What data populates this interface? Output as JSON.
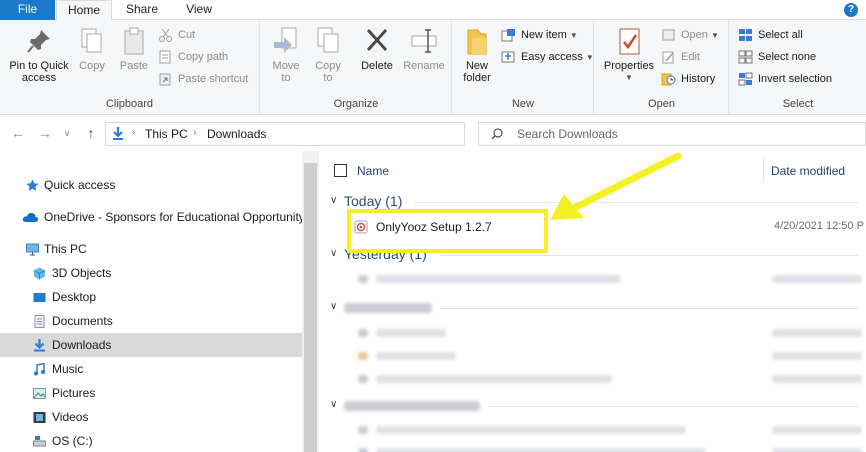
{
  "tabs": {
    "file": "File",
    "home": "Home",
    "share": "Share",
    "view": "View"
  },
  "ribbon": {
    "clipboard": {
      "label": "Clipboard",
      "pin": "Pin to Quick\naccess",
      "copy": "Copy",
      "paste": "Paste",
      "cut": "Cut",
      "copy_path": "Copy path",
      "paste_shortcut": "Paste shortcut"
    },
    "organize": {
      "label": "Organize",
      "move_to": "Move\nto",
      "copy_to": "Copy\nto",
      "delete": "Delete",
      "rename": "Rename"
    },
    "new": {
      "label": "New",
      "new_folder": "New\nfolder",
      "new_item": "New item",
      "easy_access": "Easy access"
    },
    "open": {
      "label": "Open",
      "properties": "Properties",
      "open": "Open",
      "edit": "Edit",
      "history": "History"
    },
    "select": {
      "label": "Select",
      "select_all": "Select all",
      "select_none": "Select none",
      "invert_selection": "Invert selection"
    }
  },
  "address": {
    "crumbs": [
      "This PC",
      "Downloads"
    ],
    "search_placeholder": "Search Downloads"
  },
  "navpane": {
    "items": [
      {
        "label": "Quick access",
        "icon": "star-icon"
      },
      {
        "label": "OneDrive - Sponsors for Educational Opportunity",
        "icon": "cloud-icon"
      },
      {
        "label": "This PC",
        "icon": "computer-icon"
      },
      {
        "label": "3D Objects",
        "icon": "cube-icon"
      },
      {
        "label": "Desktop",
        "icon": "desktop-icon"
      },
      {
        "label": "Documents",
        "icon": "documents-icon"
      },
      {
        "label": "Downloads",
        "icon": "download-icon"
      },
      {
        "label": "Music",
        "icon": "music-icon"
      },
      {
        "label": "Pictures",
        "icon": "pictures-icon"
      },
      {
        "label": "Videos",
        "icon": "videos-icon"
      },
      {
        "label": "OS (C:)",
        "icon": "drive-icon"
      }
    ]
  },
  "filelist": {
    "col_name": "Name",
    "col_date": "Date modified",
    "groups": [
      {
        "title": "Today (1)"
      },
      {
        "title": "Yesterday (1)"
      }
    ],
    "file": {
      "name": "OnlyYooz Setup 1.2.7",
      "date": "4/20/2021 12:50 P"
    }
  },
  "colors": {
    "accent": "#1979ca",
    "highlight": "#f4f023",
    "selected_nav": "#d9d9d9"
  }
}
